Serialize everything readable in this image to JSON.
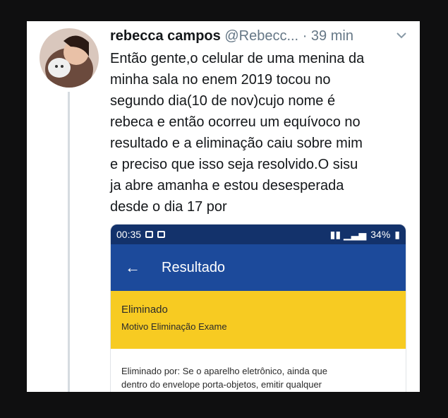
{
  "tweet": {
    "author_name": "rebecca campos",
    "handle": "@Rebecc...",
    "separator": "·",
    "time": "39 min",
    "text": "Então gente,o celular de uma menina da\nminha sala no enem 2019 tocou no\nsegundo dia(10 de nov)cujo nome é\nrebeca e então ocorreu um equívoco no\nresultado e a eliminação caiu sobre mim\ne preciso que isso seja resolvido.O sisu\nja abre amanha e estou desesperada\ndesde o dia 17 por",
    "icons": {
      "menu": "chevron-down-icon",
      "avatar": "avatar"
    }
  },
  "attached_screenshot": {
    "status_bar": {
      "time": "00:35",
      "battery": "34%"
    },
    "app_bar": {
      "title": "Resultado",
      "back_icon": "arrow-left-icon"
    },
    "result": {
      "status": "Eliminado",
      "reason": "Motivo Eliminação Exame"
    },
    "detail_text": "Eliminado por: Se o aparelho eletrônico, ainda que\ndentro do envelope porta-objetos, emitir qualquer"
  },
  "colors": {
    "status_bar": "#13326b",
    "app_bar": "#1c4a9b",
    "result_banner": "#f7cb22",
    "background": "#0f0f10"
  }
}
